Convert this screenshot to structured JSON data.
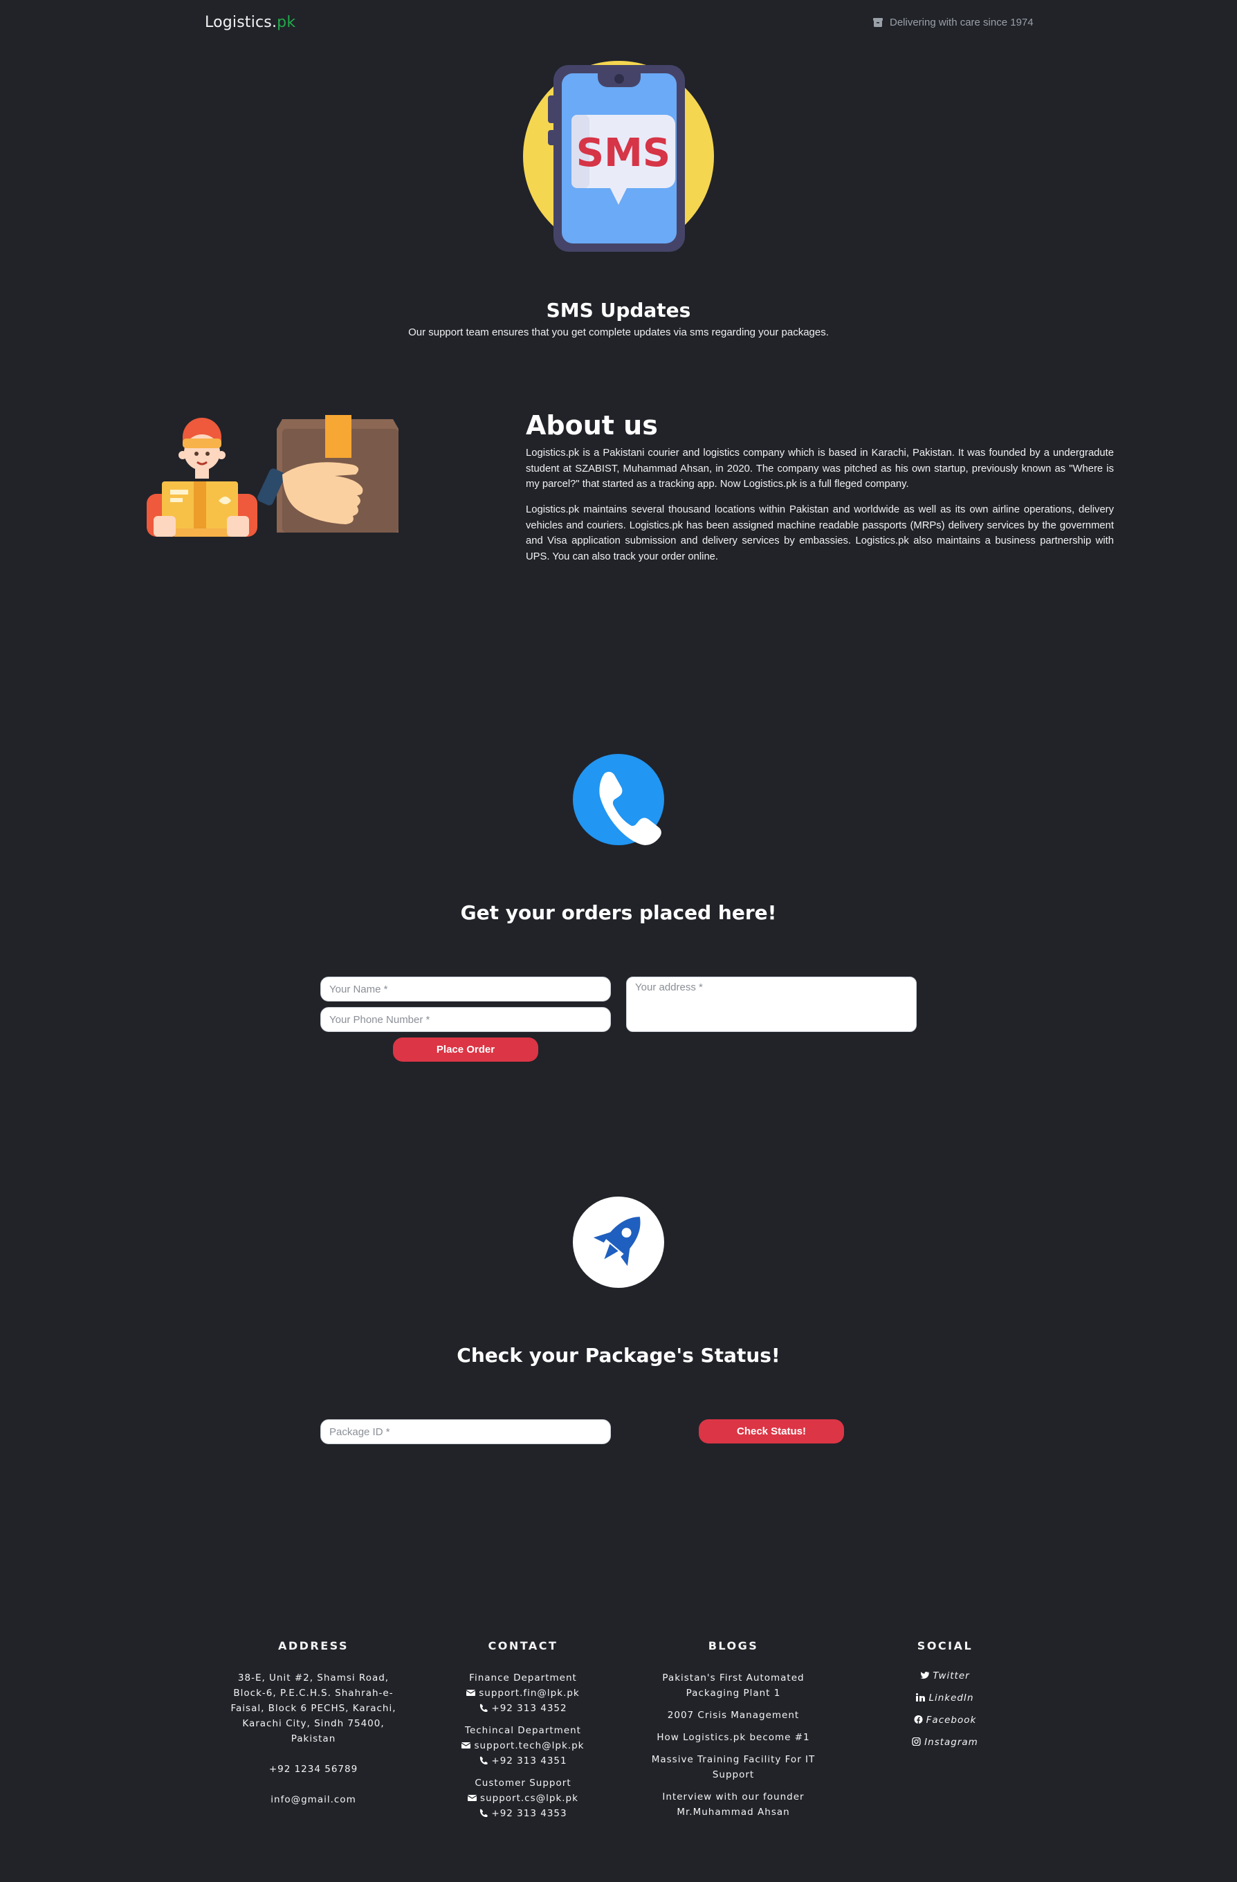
{
  "navbar": {
    "brand_main": "Logistics.",
    "brand_tld": "pk",
    "tagline": "Delivering with care since 1974",
    "tagline_icon": "box-icon"
  },
  "sms": {
    "badge_text": "SMS",
    "title": "SMS Updates",
    "description": "Our support team ensures that you get complete updates via sms regarding your packages."
  },
  "about": {
    "title": "About us",
    "paragraph1": "Logistics.pk is a Pakistani courier and logistics company which is based in Karachi, Pakistan. It was founded by a undergradute student at SZABIST, Muhammad Ahsan, in 2020. The company was pitched as his own startup, previously known as \"Where is my parcel?\" that started as a tracking app. Now Logistics.pk is a full fleged company.",
    "paragraph2": "Logistics.pk maintains several thousand locations within Pakistan and worldwide as well as its own airline operations, delivery vehicles and couriers. Logistics.pk has been assigned machine readable passports (MRPs) delivery services by the government and Visa application submission and delivery services by embassies. Logistics.pk also maintains a business partnership with UPS. You can also track your order online."
  },
  "order": {
    "title": "Get your orders placed here!",
    "name_placeholder": "Your Name *",
    "phone_placeholder": "Your Phone Number *",
    "address_placeholder": "Your address *",
    "submit_label": "Place Order"
  },
  "status": {
    "title": "Check your Package's Status!",
    "package_placeholder": "Package ID *",
    "submit_label": "Check Status!"
  },
  "colors": {
    "background": "#212329",
    "brand_accent": "#22a94a",
    "button_red": "#dc3545",
    "phone_blue": "#2196f3",
    "sms_yellow": "#f5d650"
  },
  "footer": {
    "address": {
      "heading": "ADDRESS",
      "street": "38-E, Unit #2, Shamsi Road, Block-6, P.E.C.H.S. Shahrah-e-Faisal, Block 6 PECHS, Karachi, Karachi City, Sindh 75400, Pakistan",
      "phone": "+92 1234 56789",
      "email": "info@gmail.com"
    },
    "contact": {
      "heading": "CONTACT",
      "departments": [
        {
          "name": "Finance Department",
          "email": "support.fin@lpk.pk",
          "phone": "+92 313 4352"
        },
        {
          "name": "Techincal Department",
          "email": "support.tech@lpk.pk",
          "phone": "+92 313 4351"
        },
        {
          "name": "Customer Support",
          "email": "support.cs@lpk.pk",
          "phone": "+92 313 4353"
        }
      ]
    },
    "blogs": {
      "heading": "BLOGS",
      "items": [
        "Pakistan's First Automated Packaging Plant 1",
        "2007 Crisis Management",
        "How Logistics.pk become #1",
        "Massive Training Facility For IT Support",
        "Interview with our founder Mr.Muhammad Ahsan"
      ]
    },
    "social": {
      "heading": "SOCIAL",
      "items": [
        {
          "label": "Twitter",
          "icon": "twitter-icon"
        },
        {
          "label": "LinkedIn",
          "icon": "linkedin-icon"
        },
        {
          "label": "Facebook",
          "icon": "facebook-icon"
        },
        {
          "label": "Instagram",
          "icon": "instagram-icon"
        }
      ]
    }
  }
}
